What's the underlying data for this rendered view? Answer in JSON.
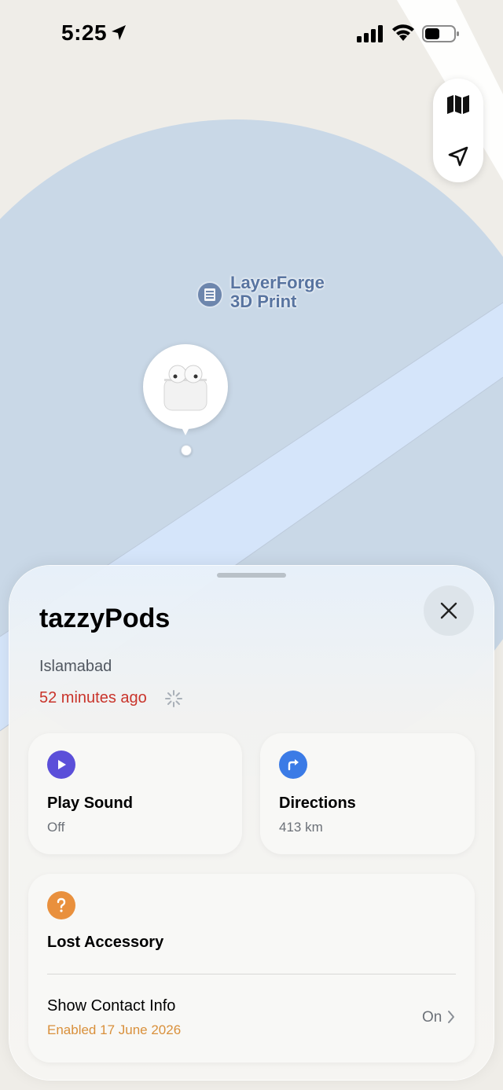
{
  "status_bar": {
    "time": "5:25"
  },
  "map": {
    "poi_label_line1": "LayerForge",
    "poi_label_line2": "3D Print",
    "colors": {
      "land": "#efede8",
      "accuracy_circle": "#c9d8e7",
      "road": "#d5e5fa"
    }
  },
  "device": {
    "name": "tazzyPods",
    "location": "Islamabad",
    "last_seen": "52 minutes ago"
  },
  "actions": {
    "play_sound": {
      "title": "Play Sound",
      "status": "Off",
      "icon": "play-icon",
      "color": "#5b4fd9"
    },
    "directions": {
      "title": "Directions",
      "distance": "413 km",
      "icon": "turn-right-arrow-icon",
      "color": "#3b7be6"
    }
  },
  "lost_accessory": {
    "title": "Lost Accessory",
    "icon": "question-mark-icon",
    "color": "#e9903d",
    "contact": {
      "label": "Show Contact Info",
      "date": "Enabled 17 June 2026",
      "state": "On"
    }
  }
}
